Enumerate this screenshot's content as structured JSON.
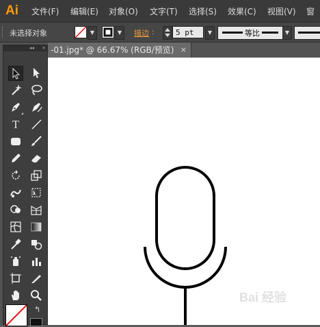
{
  "app": {
    "logo": "Ai",
    "brand_color": "#ff9a00"
  },
  "menu": {
    "items": [
      "文件(F)",
      "编辑(E)",
      "对象(O)",
      "文字(T)",
      "选择(S)",
      "效果(C)",
      "视图(V)",
      "窗"
    ]
  },
  "control_bar": {
    "selection_status": "未选择对象",
    "stroke_label": "描边",
    "stroke_label_color": "#e89a3c",
    "stroke_weight": "5 pt",
    "profile_label": "等比"
  },
  "toolbox": {
    "header_arrows": "◂◂",
    "close": "×",
    "tools": [
      "selection-tool",
      "direct-selection-tool",
      "magic-wand-tool",
      "lasso-tool",
      "pen-tool",
      "curvature-tool",
      "type-tool",
      "line-tool",
      "rectangle-tool",
      "paintbrush-tool",
      "pencil-tool",
      "eraser-tool",
      "rotate-tool",
      "scale-tool",
      "warp-tool",
      "free-transform-tool",
      "shape-builder-tool",
      "perspective-grid-tool",
      "mesh-tool",
      "gradient-tool",
      "eyedropper-tool",
      "blend-tool",
      "symbol-sprayer-tool",
      "column-graph-tool",
      "artboard-tool",
      "slice-tool",
      "hand-tool",
      "zoom-tool"
    ],
    "glyphs": {
      "type": "T"
    }
  },
  "document": {
    "tab_title": "-01.jpg* @ 66.67% (RGB/预览)",
    "tab_close": "×"
  },
  "watermark": "Bai 经验"
}
